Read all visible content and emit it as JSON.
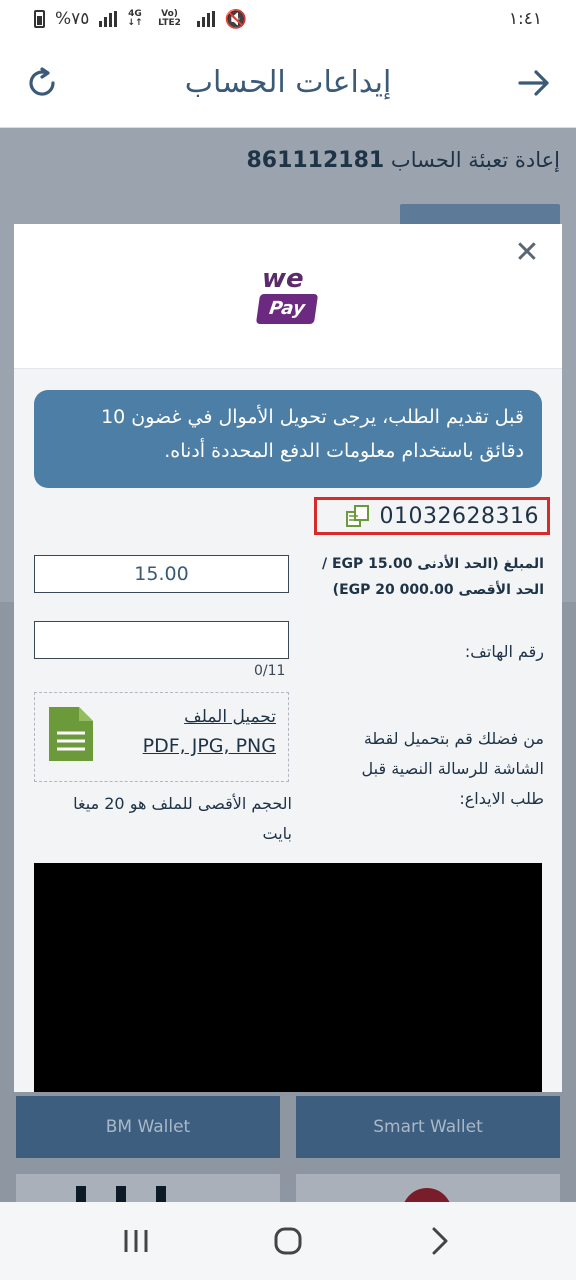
{
  "status_bar": {
    "battery": "%٧٥",
    "network": "4G",
    "lte": "Vo) LTE2",
    "time": "١:٤١"
  },
  "header": {
    "title": "إيداعات الحساب",
    "back_icon": "arrow-right-icon",
    "refresh_icon": "refresh-icon"
  },
  "background": {
    "account_label": "إعادة تعبئة الحساب",
    "account_number": "861112181",
    "wallets": [
      "BM Wallet",
      "Smart Wallet"
    ]
  },
  "modal": {
    "close_icon": "close-icon",
    "logo": {
      "top": "we",
      "bottom": "Pay"
    },
    "notice_line1": "قبل تقديم الطلب، يرجى تحويل الأموال في غضون 10",
    "notice_line2": "دقائق باستخدام معلومات الدفع المحددة أدناه.",
    "payment_phone": "01032628316",
    "amount_label_line1": "المبلغ (الحد الأدنى EGP 15.00 /",
    "amount_label_line2": "الحد الأقصى EGP 20 000.00)",
    "amount_value": "15.00",
    "phone_label": "رقم الهاتف:",
    "phone_value": "",
    "char_count": "0/11",
    "upload_instruction_line1": "من فضلك قم بتحميل لقطة",
    "upload_instruction_line2": "الشاشة للرسالة النصية قبل",
    "upload_instruction_line3": "طلب الايداع:",
    "upload_title": "تحميل الملف",
    "upload_types": "PDF, JPG, PNG",
    "size_note_line1": "الحجم الأقصى للملف هو 20 ميغا",
    "size_note_line2": "بايت"
  },
  "colors": {
    "accent": "#4d7fa6",
    "header_text": "#3a5a78",
    "highlight": "#d62b2b",
    "file_icon": "#6a9a3a"
  }
}
